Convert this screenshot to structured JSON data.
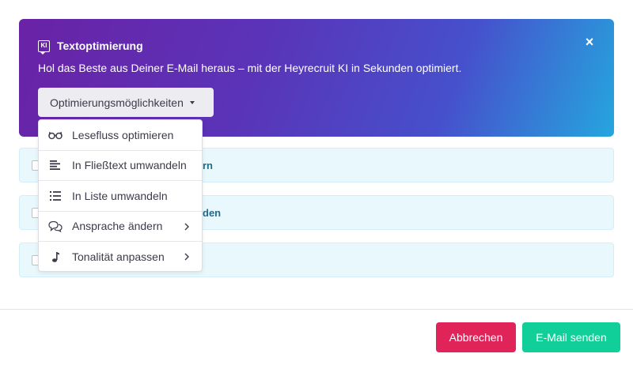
{
  "banner": {
    "badge_text": "KI",
    "title": "Textoptimierung",
    "description": "Hol das Beste aus Deiner E-Mail heraus – mit der Heyrecruit KI in Sekunden optimiert.",
    "close_icon": "close-icon",
    "options_button_label": "Optimierungsmöglichkeiten"
  },
  "rows": [
    {
      "label_visible": "rn"
    },
    {
      "label_visible": "den"
    },
    {
      "label_visible": ""
    }
  ],
  "menu": {
    "items": [
      {
        "label": "Lesefluss optimieren",
        "icon": "glasses-icon",
        "has_submenu": false
      },
      {
        "label": "In Fließtext umwandeln",
        "icon": "align-left-icon",
        "has_submenu": false
      },
      {
        "label": "In Liste umwandeln",
        "icon": "list-icon",
        "has_submenu": false
      },
      {
        "label": "Ansprache ändern",
        "icon": "speech-bubbles-icon",
        "has_submenu": true
      },
      {
        "label": "Tonalität anpassen",
        "icon": "music-note-icon",
        "has_submenu": true
      }
    ]
  },
  "footer": {
    "cancel_label": "Abbrechen",
    "send_label": "E-Mail senden"
  },
  "colors": {
    "gradient_start": "#6a22a6",
    "gradient_end": "#25a6de",
    "cancel": "#e0245a",
    "send": "#10cf98",
    "row_bg": "#e8f8fc"
  }
}
